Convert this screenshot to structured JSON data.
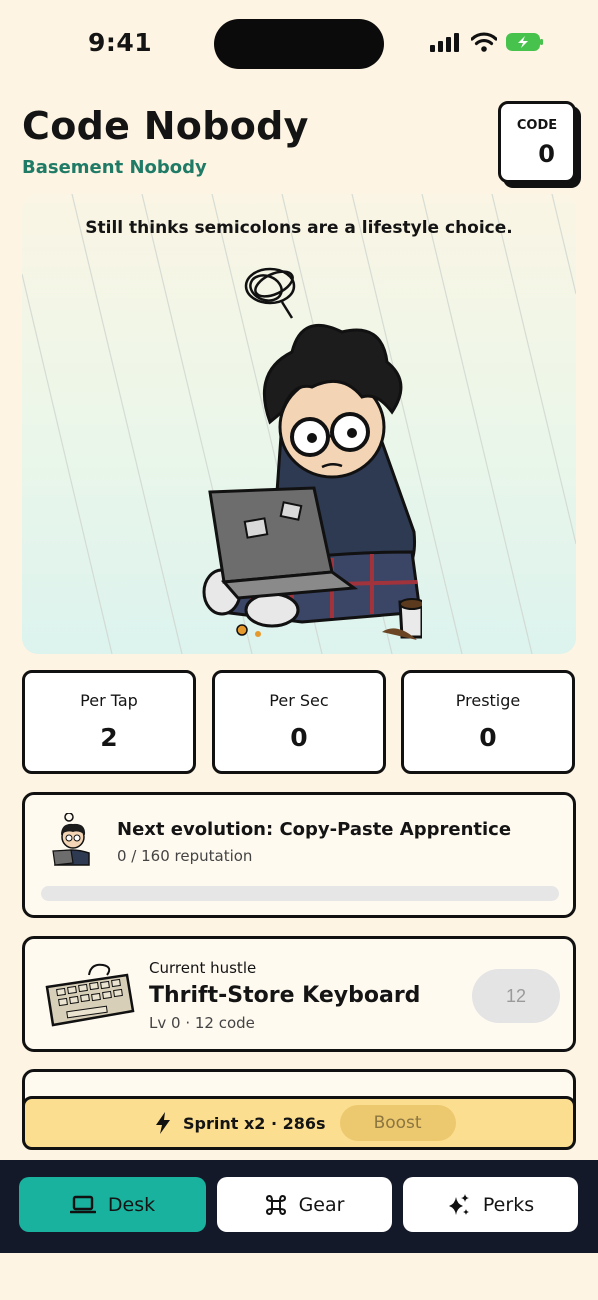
{
  "status_bar": {
    "time": "9:41"
  },
  "header": {
    "title": "Code Nobody",
    "subtitle": "Basement Nobody",
    "code_label": "CODE",
    "code_value": "0"
  },
  "hero": {
    "quote": "Still thinks semicolons are a lifestyle choice."
  },
  "stats": [
    {
      "label": "Per Tap",
      "value": "2"
    },
    {
      "label": "Per Sec",
      "value": "0"
    },
    {
      "label": "Prestige",
      "value": "0"
    }
  ],
  "evolution": {
    "title": "Next evolution: Copy-Paste Apprentice",
    "progress_text": "0 / 160 reputation",
    "progress": 0
  },
  "hustle": {
    "kicker": "Current hustle",
    "name": "Thrift-Store Keyboard",
    "meta": "Lv 0 · 12 code",
    "buy_label": "12"
  },
  "sprint": {
    "text": "Sprint x2 · 286s",
    "boost_label": "Boost"
  },
  "tabs": [
    {
      "label": "Desk",
      "icon": "laptop-icon",
      "active": true
    },
    {
      "label": "Gear",
      "icon": "command-icon",
      "active": false
    },
    {
      "label": "Perks",
      "icon": "sparkles-icon",
      "active": false
    }
  ],
  "colors": {
    "background": "#fdf4e3",
    "accent": "#19b29e",
    "subtitle": "#1f7a66",
    "sprint": "#fbde8f",
    "tabbar": "#14192a"
  }
}
